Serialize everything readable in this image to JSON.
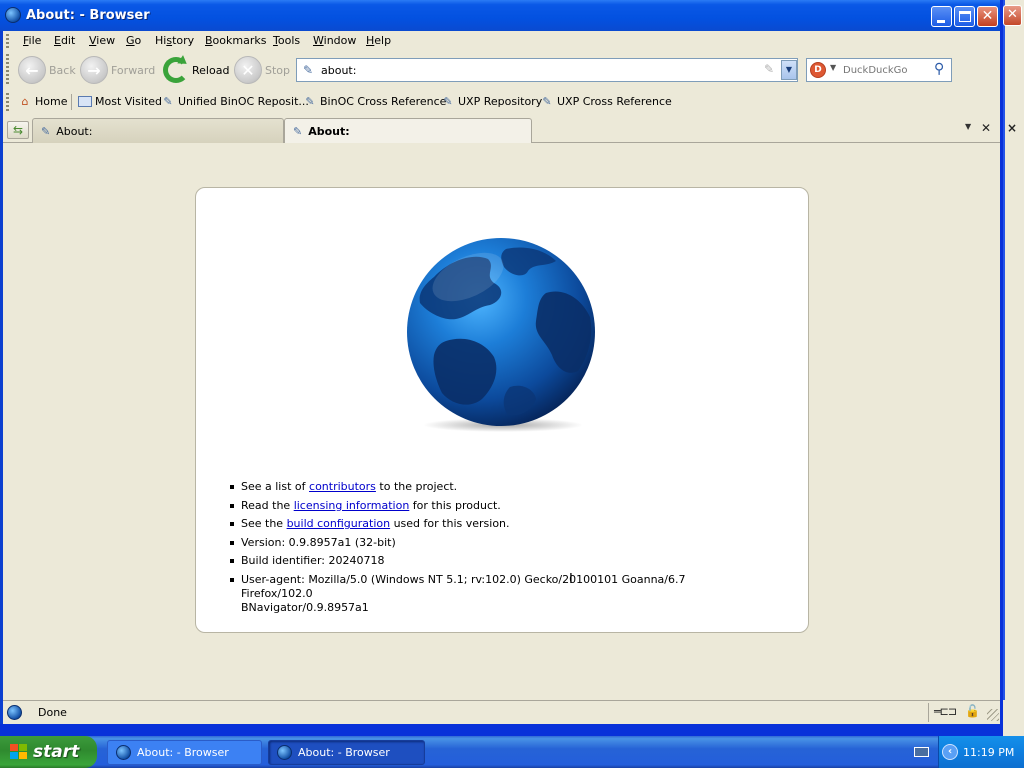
{
  "window": {
    "title": "About: - Browser",
    "close_glyph": "✕"
  },
  "menu": {
    "items": [
      {
        "pre": "",
        "key": "F",
        "post": "ile"
      },
      {
        "pre": "",
        "key": "E",
        "post": "dit"
      },
      {
        "pre": "",
        "key": "V",
        "post": "iew"
      },
      {
        "pre": "",
        "key": "G",
        "post": "o"
      },
      {
        "pre": "Hi",
        "key": "s",
        "post": "tory"
      },
      {
        "pre": "",
        "key": "B",
        "post": "ookmarks"
      },
      {
        "pre": "",
        "key": "T",
        "post": "ools"
      },
      {
        "pre": "",
        "key": "W",
        "post": "indow"
      },
      {
        "pre": "",
        "key": "H",
        "post": "elp"
      }
    ]
  },
  "navbar": {
    "back_label": "Back",
    "forward_label": "Forward",
    "reload_label": "Reload",
    "stop_label": "Stop",
    "url": "about:",
    "search_engine": "DuckDuckGo"
  },
  "bookmarks": {
    "home": "Home",
    "most_visited": "Most Visited",
    "items": [
      "Unified BinOC Reposit...",
      "BinOC Cross Reference",
      "UXP Repository",
      "UXP Cross Reference"
    ]
  },
  "tabs": [
    {
      "label": "About:",
      "active": false
    },
    {
      "label": "About:",
      "active": true
    }
  ],
  "about": {
    "contributors": {
      "pre": "See a list of ",
      "link": "contributors",
      "post": " to the project."
    },
    "licensing": {
      "pre": "Read the ",
      "link": "licensing information",
      "post": " for this product."
    },
    "build_config": {
      "pre": "See the ",
      "link": "build configuration",
      "post": " used for this version."
    },
    "version": "Version: 0.9.8957a1 (32-bit)",
    "build_id": "Build identifier: 20240718",
    "user_agent_line1": "User-agent: Mozilla/5.0 (Windows NT 5.1; rv:102.0) Gecko/20100101 Goanna/6.7 Firefox/102.0",
    "user_agent_line2": "BNavigator/0.9.8957a1"
  },
  "status": {
    "text": "Done"
  },
  "taskbar": {
    "start_label": "start",
    "tasks": [
      "About: - Browser",
      "About: - Browser"
    ],
    "clock": "11:19 PM"
  },
  "colors": {
    "titlebar": "#0351e0",
    "chrome_bg": "#ece9d8",
    "link": "#0000cc",
    "start_green": "#3aa53a",
    "taskbar_blue": "#245edb"
  }
}
